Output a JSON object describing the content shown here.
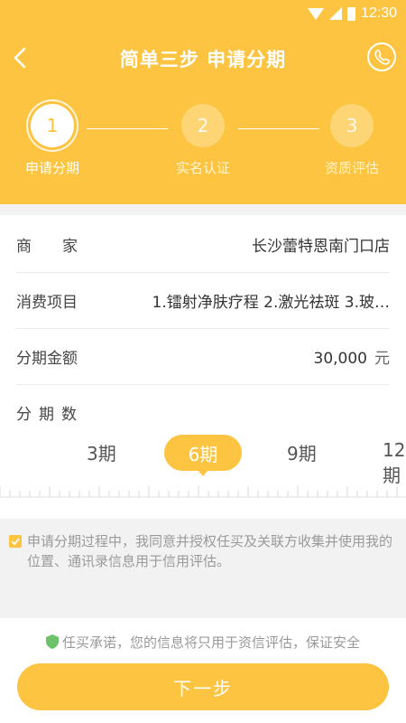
{
  "status_bar": {
    "time": "12:30"
  },
  "nav": {
    "title": "简单三步 申请分期"
  },
  "steps": [
    {
      "number": "1",
      "label": "申请分期",
      "active": true
    },
    {
      "number": "2",
      "label": "实名认证",
      "active": false
    },
    {
      "number": "3",
      "label": "资质评估",
      "active": false
    }
  ],
  "form": {
    "merchant_label": "商　　家",
    "merchant_value": "长沙蕾特恩南门口店",
    "items_label": "消费项目",
    "items_value": "1.镭射净肤疗程 2.激光祛斑 3.玻…",
    "amount_label": "分期金额",
    "amount_value": "30,000",
    "amount_unit": "元",
    "periods_label": "分期数"
  },
  "period_options": [
    "3期",
    "6期",
    "9期",
    "12期"
  ],
  "selected_period": "6期",
  "consent": {
    "checked": true,
    "text": "申请分期过程中，我同意并授权任买及关联方收集并使用我的位置、通讯录信息用于信用评估。"
  },
  "privacy_note": "任买承诺，您的信息将只用于资信评估，保证安全",
  "next_button": "下一步",
  "colors": {
    "brand": "#fdc441",
    "shield": "#6cc26b"
  }
}
